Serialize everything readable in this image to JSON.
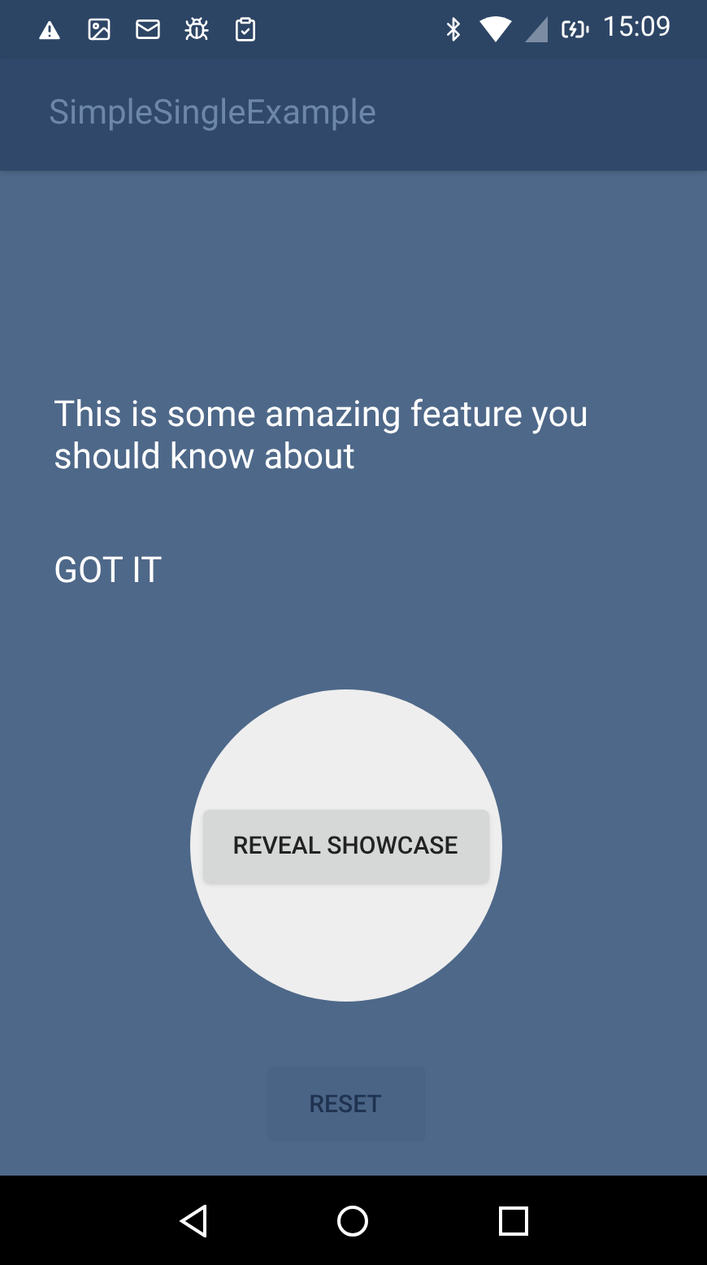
{
  "status_bar": {
    "time": "15:09"
  },
  "app_bar": {
    "title": "SimpleSingleExample"
  },
  "showcase": {
    "message": "This is some amazing feature you should know about",
    "dismiss": "GOT IT"
  },
  "buttons": [
    {
      "label": "REVEAL SHOWCASE",
      "highlighted": true
    },
    {
      "label": "RESET",
      "highlighted": false
    }
  ]
}
